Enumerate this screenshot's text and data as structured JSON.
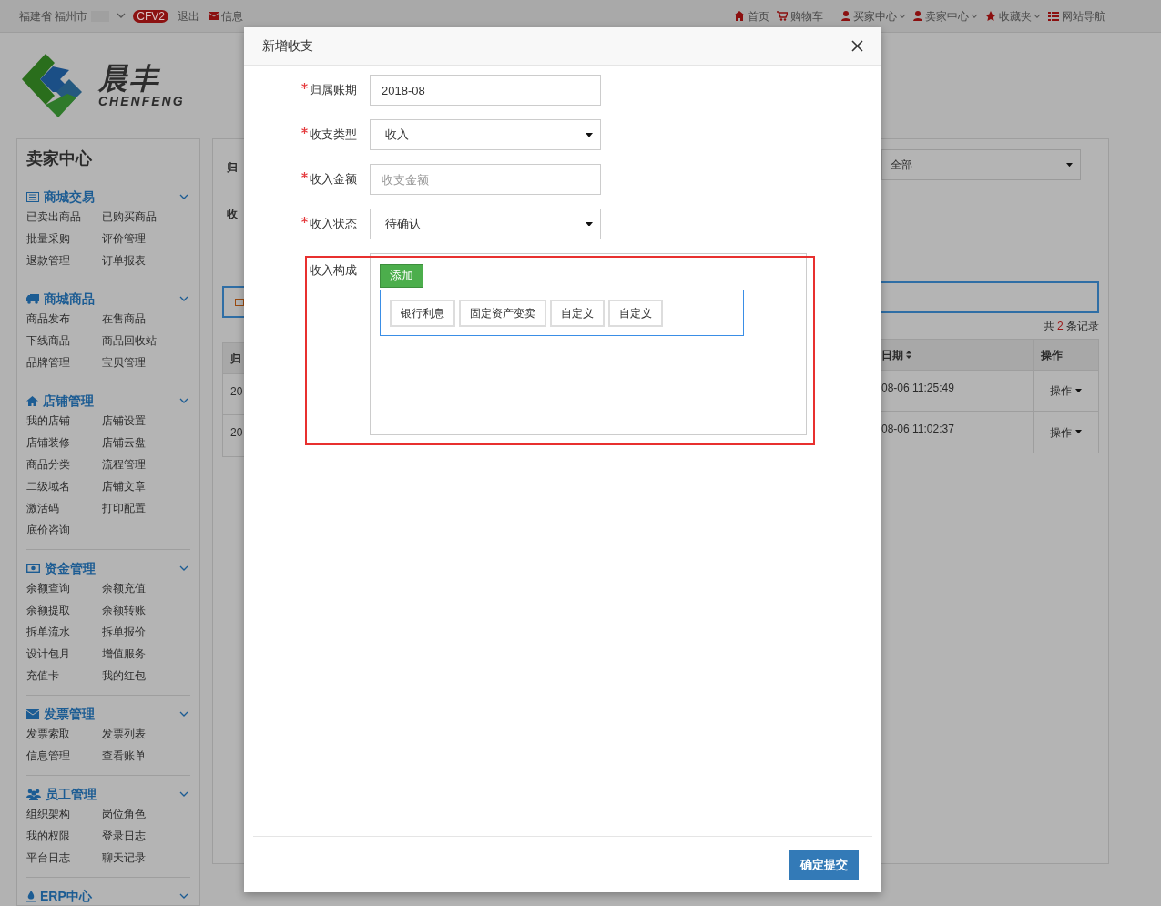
{
  "top_bar": {
    "location": "福建省 福州市",
    "badge": "CFV2",
    "left_links": [
      {
        "label": "退出",
        "kind": "text"
      },
      {
        "label": "信息",
        "kind": "mail"
      }
    ],
    "right_links": [
      {
        "label": "首页",
        "has_menu": false
      },
      {
        "label": "购物车",
        "has_menu": false
      },
      {
        "label": "买家中心",
        "has_menu": true
      },
      {
        "label": "卖家中心",
        "has_menu": true
      },
      {
        "label": "收藏夹",
        "has_menu": true
      },
      {
        "label": "网站导航",
        "has_menu": false
      }
    ]
  },
  "logo": {
    "name": "晨丰",
    "subtitle": "CHENFENG"
  },
  "sidebar": {
    "title": "卖家中心",
    "sections": [
      {
        "title": "商城交易",
        "items": [
          "已卖出商品",
          "已购买商品",
          "批量采购",
          "评价管理",
          "退款管理",
          "订单报表"
        ]
      },
      {
        "title": "商城商品",
        "items": [
          "商品发布",
          "在售商品",
          "下线商品",
          "商品回收站",
          "品牌管理",
          "宝贝管理"
        ]
      },
      {
        "title": "店铺管理",
        "items": [
          "我的店铺",
          "店铺设置",
          "店铺装修",
          "店铺云盘",
          "商品分类",
          "流程管理",
          "二级域名",
          "店铺文章",
          "激活码",
          "打印配置",
          "底价咨询"
        ]
      },
      {
        "title": "资金管理",
        "items": [
          "余额查询",
          "余额充值",
          "余额提取",
          "余额转账",
          "拆单流水",
          "拆单报价",
          "设计包月",
          "增值服务",
          "充值卡",
          "我的红包"
        ]
      },
      {
        "title": "发票管理",
        "items": [
          "发票索取",
          "发票列表",
          "信息管理",
          "查看账单"
        ]
      },
      {
        "title": "员工管理",
        "items": [
          "组织架构",
          "岗位角色",
          "我的权限",
          "登录日志",
          "平台日志",
          "聊天记录"
        ]
      },
      {
        "title": "ERP中心"
      }
    ]
  },
  "main": {
    "filter_fragments": [
      "归",
      "收"
    ],
    "status_filter": "全部",
    "record_count": {
      "prefix": "共",
      "count": "2",
      "suffix": "条记录"
    },
    "header_fragment": "归",
    "columns": [
      "日期",
      "操作"
    ],
    "rows": [
      {
        "fragment": "20",
        "date": "08-06 11:25:49",
        "action": "操作"
      },
      {
        "fragment": "20",
        "date": "08-06 11:02:37",
        "action": "操作"
      }
    ]
  },
  "modal": {
    "title": "新增收支",
    "fields": [
      {
        "kind": "text",
        "label": "归属账期",
        "required": true,
        "value": "2018-08"
      },
      {
        "kind": "select",
        "label": "收支类型",
        "required": true,
        "value": "收入"
      },
      {
        "kind": "text",
        "label": "收入金额",
        "required": true,
        "placeholder": "收支金额"
      },
      {
        "kind": "select",
        "label": "收入状态",
        "required": true,
        "value": "待确认"
      }
    ],
    "composition": {
      "label": "收入构成",
      "add_button": "添加",
      "tags": [
        "银行利息",
        "固定资产变卖",
        "自定义",
        "自定义"
      ]
    },
    "submit": "确定提交"
  }
}
